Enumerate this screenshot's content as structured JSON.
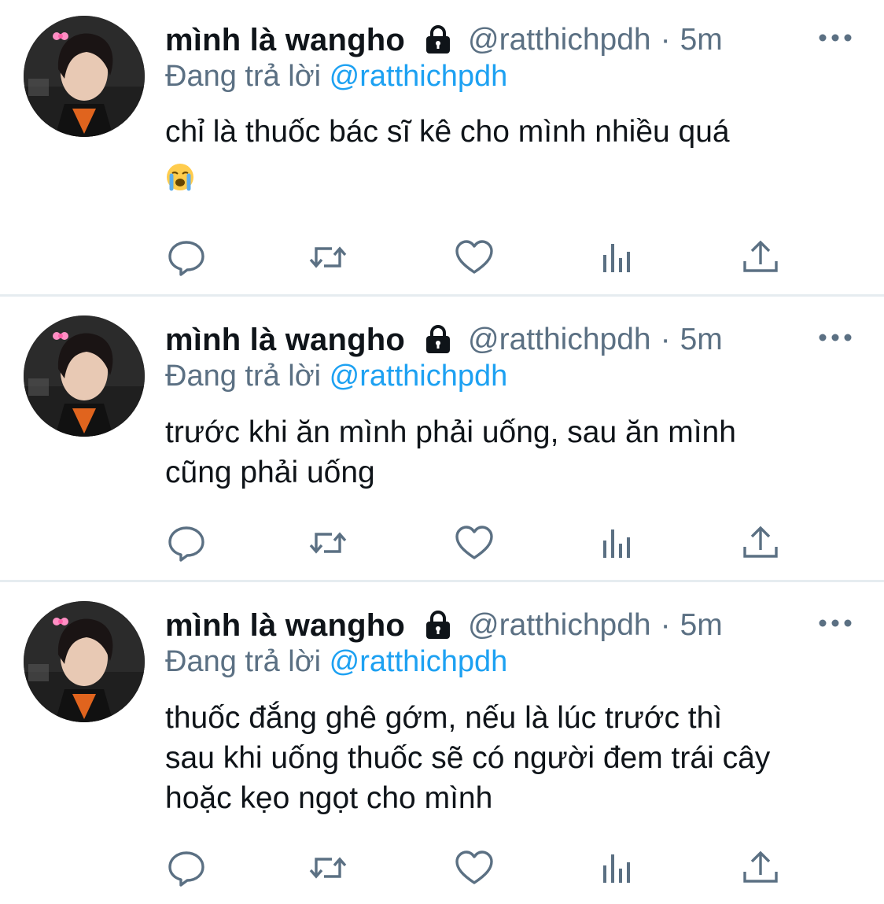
{
  "tweets": [
    {
      "display_name": "mình là wangho",
      "handle": "@ratthichpdh",
      "separator": "·",
      "time": "5m",
      "reply_prefix": "Đang trả lời",
      "reply_to": "@ratthichpdh",
      "text_lines": [
        "chỉ là thuốc bác sĩ kê cho mình nhiều quá"
      ],
      "emoji": "loudly-crying-face-emoji",
      "locked": true
    },
    {
      "display_name": "mình là wangho",
      "handle": "@ratthichpdh",
      "separator": "·",
      "time": "5m",
      "reply_prefix": "Đang trả lời",
      "reply_to": "@ratthichpdh",
      "text_lines": [
        "trước khi ăn mình phải uống, sau ăn mình",
        "cũng phải uống"
      ],
      "locked": true
    },
    {
      "display_name": "mình là wangho",
      "handle": "@ratthichpdh",
      "separator": "·",
      "time": "5m",
      "reply_prefix": "Đang trả lời",
      "reply_to": "@ratthichpdh",
      "text_lines": [
        "thuốc đắng ghê gớm, nếu là lúc trước thì",
        "sau khi uống thuốc sẽ có người đem trái cây",
        "hoặc kẹo ngọt cho mình"
      ],
      "locked": true
    }
  ],
  "icons": {
    "lock": "lock-icon",
    "more": "more-icon",
    "reply": "reply-icon",
    "retweet": "retweet-icon",
    "like": "like-icon",
    "analytics": "analytics-icon",
    "share": "share-icon"
  },
  "colors": {
    "text": "#0f1419",
    "secondary": "#5b7083",
    "link": "#1da1f2",
    "divider": "#e6ecf0"
  }
}
